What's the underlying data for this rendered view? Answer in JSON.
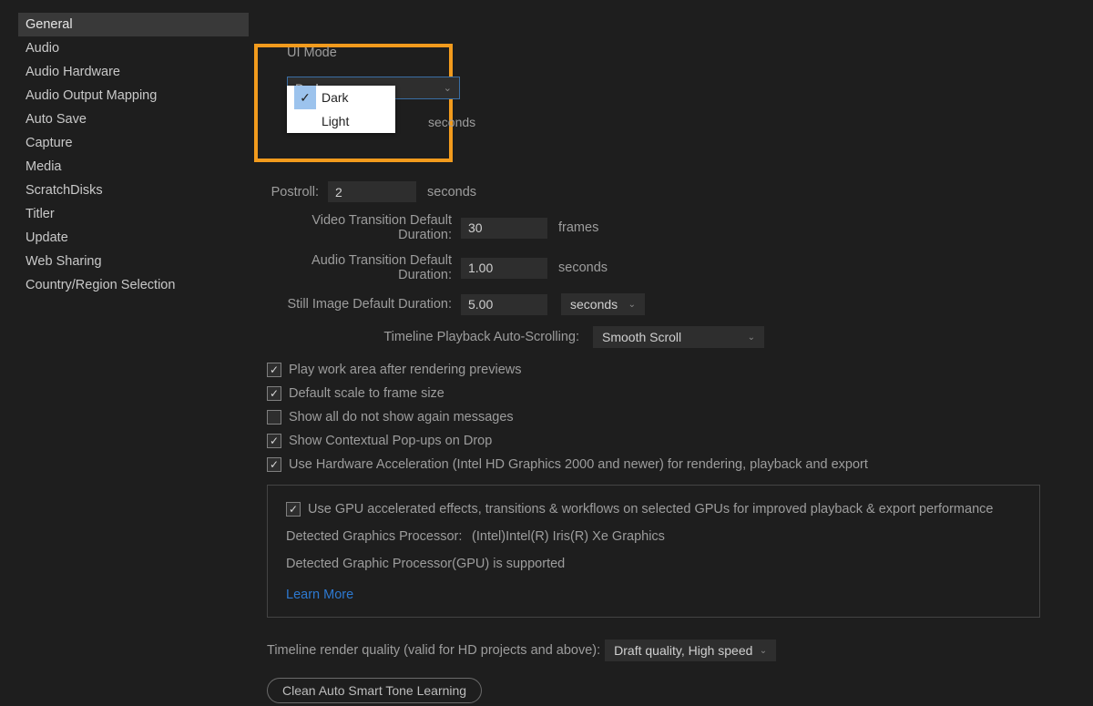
{
  "sidebar": {
    "items": [
      "General",
      "Audio",
      "Audio Hardware",
      "Audio Output Mapping",
      "Auto Save",
      "Capture",
      "Media",
      "ScratchDisks",
      "Titler",
      "Update",
      "Web Sharing",
      "Country/Region Selection"
    ],
    "selected": "General"
  },
  "uiMode": {
    "label": "UI Mode",
    "selected": "Dark",
    "options": [
      "Dark",
      "Light"
    ]
  },
  "postroll": {
    "label": "Postroll:",
    "value": "2",
    "unit": "seconds"
  },
  "preroll_hidden_unit": "seconds",
  "videoTransition": {
    "label": "Video Transition Default Duration:",
    "value": "30",
    "unit": "frames"
  },
  "audioTransition": {
    "label": "Audio Transition Default Duration:",
    "value": "1.00",
    "unit": "seconds"
  },
  "stillImage": {
    "label": "Still Image Default Duration:",
    "value": "5.00",
    "unit": "seconds"
  },
  "timelineScroll": {
    "label": "Timeline Playback Auto-Scrolling:",
    "value": "Smooth Scroll"
  },
  "checks": {
    "playAfterRender": {
      "label": "Play work area after rendering previews",
      "checked": true
    },
    "defaultScale": {
      "label": "Default scale to frame size",
      "checked": true
    },
    "showAll": {
      "label": "Show all do not show again messages",
      "checked": false
    },
    "contextual": {
      "label": "Show Contextual Pop-ups on Drop",
      "checked": true
    },
    "hwAccel": {
      "label": "Use Hardware Acceleration (Intel HD Graphics 2000 and newer) for rendering, playback and export",
      "checked": true
    }
  },
  "gpu": {
    "useGpu": {
      "label": "Use GPU accelerated effects, transitions & workflows on selected GPUs for improved playback & export performance",
      "checked": true
    },
    "detectedLabel": "Detected Graphics Processor:",
    "detectedValue": "(Intel)Intel(R) Iris(R) Xe Graphics",
    "supported": "Detected Graphic Processor(GPU) is supported",
    "learn": "Learn More"
  },
  "renderQuality": {
    "label": "Timeline render quality (valid for HD projects and above):",
    "value": "Draft quality, High speed"
  },
  "cleanButton": "Clean Auto Smart Tone Learning"
}
